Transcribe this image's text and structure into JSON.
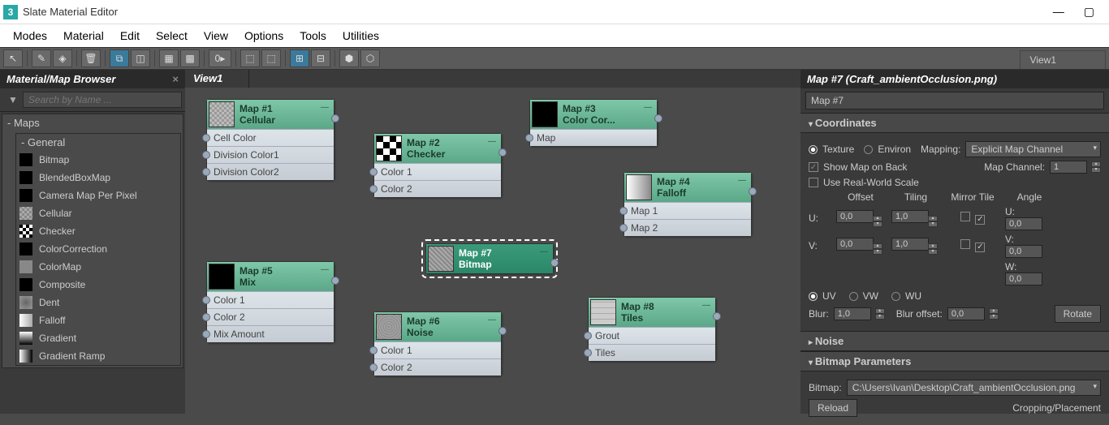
{
  "window": {
    "title": "Slate Material Editor",
    "icon_text": "3"
  },
  "menu": [
    "Modes",
    "Material",
    "Edit",
    "Select",
    "View",
    "Options",
    "Tools",
    "Utilities"
  ],
  "view_tab": "View1",
  "browser": {
    "title": "Material/Map Browser",
    "search_placeholder": "Search by Name ...",
    "groups": {
      "maps": "Maps",
      "general": "General"
    },
    "items": [
      "Bitmap",
      "BlendedBoxMap",
      "Camera Map Per Pixel",
      "Cellular",
      "Checker",
      "ColorCorrection",
      "ColorMap",
      "Composite",
      "Dent",
      "Falloff",
      "Gradient",
      "Gradient Ramp"
    ]
  },
  "nodes": {
    "n1": {
      "title1": "Map #1",
      "title2": "Cellular",
      "slots": [
        "Cell Color",
        "Division Color1",
        "Division Color2"
      ]
    },
    "n2": {
      "title1": "Map #2",
      "title2": "Checker",
      "slots": [
        "Color 1",
        "Color 2"
      ]
    },
    "n3": {
      "title1": "Map #3",
      "title2": "Color Cor...",
      "slots": [
        "Map"
      ]
    },
    "n4": {
      "title1": "Map #4",
      "title2": "Falloff",
      "slots": [
        "Map 1",
        "Map 2"
      ]
    },
    "n5": {
      "title1": "Map #5",
      "title2": "Mix",
      "slots": [
        "Color 1",
        "Color 2",
        "Mix Amount"
      ]
    },
    "n6": {
      "title1": "Map #6",
      "title2": "Noise",
      "slots": [
        "Color 1",
        "Color 2"
      ]
    },
    "n7": {
      "title1": "Map #7",
      "title2": "Bitmap",
      "slots": []
    },
    "n8": {
      "title1": "Map #8",
      "title2": "Tiles",
      "slots": [
        "Grout",
        "Tiles"
      ]
    }
  },
  "props": {
    "header": "Map #7 (Craft_ambientOcclusion.png)",
    "name": "Map #7",
    "sections": {
      "coordinates": "Coordinates",
      "noise": "Noise",
      "bitmap_params": "Bitmap Parameters"
    },
    "texture": "Texture",
    "environ": "Environ",
    "mapping": "Mapping:",
    "mapping_val": "Explicit Map Channel",
    "show_map": "Show Map on Back",
    "map_channel": "Map Channel:",
    "map_channel_val": "1",
    "real_world": "Use Real-World Scale",
    "heads": {
      "offset": "Offset",
      "tiling": "Tiling",
      "mirror_tile": "Mirror Tile",
      "angle": "Angle"
    },
    "u": "U:",
    "v": "V:",
    "w": "W:",
    "uv": "UV",
    "vw": "VW",
    "wu": "WU",
    "vals": {
      "offU": "0,0",
      "offV": "0,0",
      "tilU": "1,0",
      "tilV": "1,0",
      "angU": "0,0",
      "angV": "0,0",
      "angW": "0,0"
    },
    "blur": "Blur:",
    "blur_val": "1,0",
    "blur_off": "Blur offset:",
    "blur_off_val": "0,0",
    "rotate": "Rotate",
    "bitmap_label": "Bitmap:",
    "bitmap_path": "C:\\Users\\Ivan\\Desktop\\Craft_ambientOcclusion.png",
    "reload": "Reload",
    "cropping": "Cropping/Placement"
  }
}
